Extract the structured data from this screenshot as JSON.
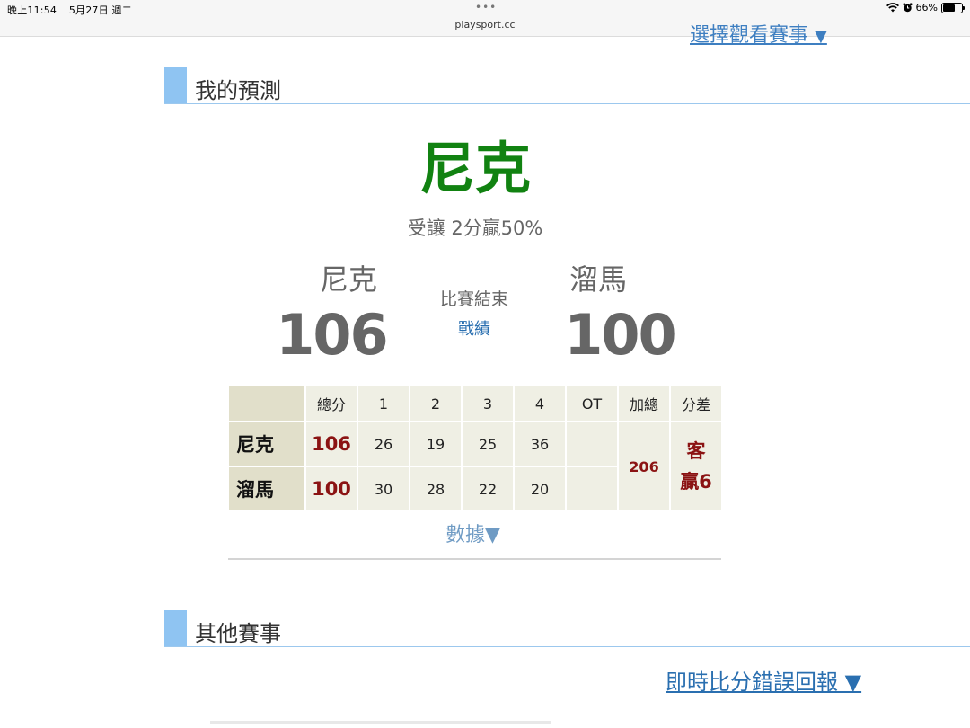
{
  "status_bar": {
    "time": "晚上11:54",
    "date": "5月27日 週二",
    "url": "playsport.cc",
    "battery": "66%",
    "battery_level": 0.66
  },
  "top_link": {
    "label": "選擇觀看賽事",
    "arrow": "▼"
  },
  "my_prediction": {
    "section_title": "我的預測",
    "pick_team": "尼克",
    "pick_detail": "受讓 2分贏50%"
  },
  "game": {
    "away": {
      "name": "尼克",
      "score": "106"
    },
    "home": {
      "name": "溜馬",
      "score": "100"
    },
    "status": "比賽結束",
    "record_link": "戰績"
  },
  "boxscore": {
    "headers": [
      "",
      "總分",
      "1",
      "2",
      "3",
      "4",
      "OT",
      "加總",
      "分差"
    ],
    "rows": [
      {
        "team": "尼克",
        "total": "106",
        "q": [
          "26",
          "19",
          "25",
          "36"
        ],
        "ot": ""
      },
      {
        "team": "溜馬",
        "total": "100",
        "q": [
          "30",
          "28",
          "22",
          "20"
        ],
        "ot": ""
      }
    ],
    "sum": "206",
    "diff_line1": "客",
    "diff_line2": "贏6"
  },
  "data_toggle": "數據▼",
  "other_games": {
    "section_title": "其他賽事"
  },
  "error_report": "即時比分錯誤回報 ▼",
  "colors": {
    "pick_green": "#118211",
    "accent_blue": "#8fc4f2",
    "score_red": "#8b1313",
    "link_blue": "#2a6fb0"
  }
}
